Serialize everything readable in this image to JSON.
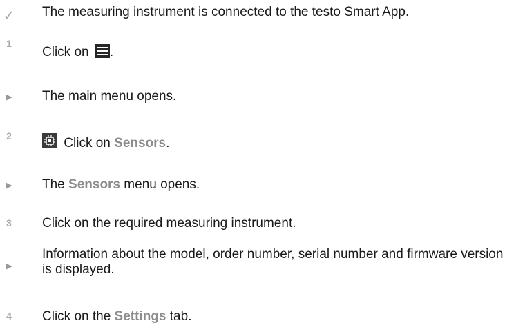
{
  "steps": [
    {
      "marker": "✓",
      "kind": "check",
      "text": "The measuring instrument is connected to the testo Smart App."
    },
    {
      "marker": "1",
      "kind": "number",
      "before": "Click on ",
      "icon": "menu-icon",
      "after": "."
    },
    {
      "marker": "▶",
      "kind": "result",
      "text": "The main menu opens."
    },
    {
      "marker": "2",
      "kind": "number",
      "icon": "sensor-chip-icon",
      "before": " Click on ",
      "highlight": "Sensors",
      "after": "."
    },
    {
      "marker": "▶",
      "kind": "result",
      "before": "The ",
      "highlight": "Sensors",
      "after": " menu opens."
    },
    {
      "marker": "3",
      "kind": "number",
      "text": "Click on the required measuring instrument."
    },
    {
      "marker": "▶",
      "kind": "result",
      "text": "Information about the model, order number, serial number and firmware version is displayed."
    },
    {
      "marker": "4",
      "kind": "number",
      "before": "Click on the ",
      "highlight": "Settings",
      "after": " tab."
    }
  ],
  "colors": {
    "text": "#1a1a1a",
    "highlight": "#8c8c8c",
    "marker": "#a9a9a9",
    "divider": "#9d9d9d"
  }
}
